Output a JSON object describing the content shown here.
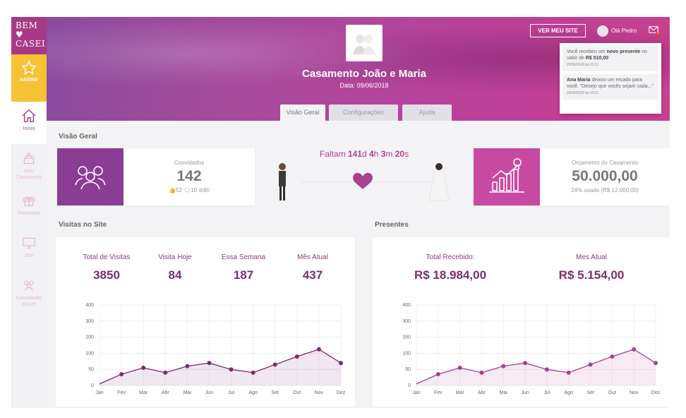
{
  "brand": {
    "logo_text_line1": "BEM ♥",
    "logo_text_line2": "CASEI"
  },
  "sidebar": {
    "assine_label": "ASSINE",
    "items": [
      {
        "label": "Início",
        "icon": "home-icon"
      },
      {
        "label": "Meu Casamento",
        "icon": "cake-icon"
      },
      {
        "label": "Presentes",
        "icon": "gift-icon"
      },
      {
        "label": "Site",
        "icon": "monitor-icon"
      },
      {
        "label": "Convidados RSVP",
        "icon": "guests-icon"
      }
    ]
  },
  "header": {
    "title": "Casamento João e Maria",
    "date": "Data: 09/06/2018",
    "tabs": [
      "Visão Geral",
      "Configurações",
      "Ajuda"
    ],
    "ver_site": "VER MEU SITE",
    "user": "Olá Pedro",
    "mail_count": "2",
    "notifications": [
      {
        "prefix": "Você recebeu um ",
        "bold": "novo presente",
        "mid": " no valor de ",
        "bold2": "R$ 510,00",
        "date": "20/06/2018 às 15:21"
      },
      {
        "prefix": "",
        "bold": "Ana Maria",
        "mid": " deixou um recado para você. \"Desejo que vocês sejam cada...\"",
        "bold2": "",
        "date": "20/06/2018 às 15:21"
      }
    ]
  },
  "overview": {
    "section_title": "Visão Geral",
    "guests": {
      "label": "Convidados",
      "value": "142",
      "meta": "👍52  🗨10  ⊘80"
    },
    "countdown": {
      "prefix": "Faltam",
      "days": "141",
      "hours": "4",
      "minutes": "3",
      "seconds": "20"
    },
    "budget": {
      "label": "Orçamento do Casamento",
      "value": "50.000,00",
      "meta": "24% usado (R$ 12.000,00)"
    }
  },
  "visits": {
    "section_title": "Visitas no Site",
    "kpis": [
      {
        "label": "Total de Visitas",
        "value": "3850"
      },
      {
        "label": "Visita Hoje",
        "value": "84"
      },
      {
        "label": "Essa Semana",
        "value": "187"
      },
      {
        "label": "Mês Atual",
        "value": "437"
      }
    ]
  },
  "gifts": {
    "section_title": "Presentes",
    "kpis": [
      {
        "label": "Total Recebido:",
        "value": "R$ 18.984,00"
      },
      {
        "label": "Mes Atual",
        "value": "R$ 5.154,00"
      }
    ]
  },
  "colors": {
    "accent": "#a8418e",
    "line": "#7b2d6e",
    "budget": "#c84aa0",
    "guests": "#8b3c95"
  },
  "chart_data": [
    {
      "type": "area",
      "title": "",
      "categories": [
        "Jan",
        "Fev",
        "Mar",
        "Abr",
        "Mai",
        "Jun",
        "Jul",
        "Ago",
        "Set",
        "Out",
        "Nov",
        "Dez"
      ],
      "series": [
        {
          "values": [
            5,
            35,
            55,
            40,
            60,
            70,
            50,
            40,
            65,
            90,
            125,
            70
          ]
        }
      ],
      "ylim": [
        0,
        400
      ],
      "yticks": [
        0,
        50,
        100,
        200,
        300,
        400
      ],
      "ytick_labels": [
        "0",
        "50",
        "100",
        "200",
        "300",
        "400"
      ],
      "grid": true
    },
    {
      "type": "area",
      "title": "",
      "categories": [
        "Jan",
        "Fev",
        "Mar",
        "Abr",
        "Mai",
        "Jun",
        "Jul",
        "Ago",
        "Set",
        "Out",
        "Nov",
        "Dez"
      ],
      "series": [
        {
          "values": [
            5,
            35,
            55,
            40,
            60,
            70,
            50,
            40,
            65,
            90,
            125,
            70
          ]
        }
      ],
      "ylim": [
        0,
        400
      ],
      "yticks": [
        0,
        50,
        100,
        200,
        300,
        400
      ],
      "ytick_labels": [
        "0",
        "50",
        "100",
        "200",
        "300",
        "400"
      ],
      "grid": true
    }
  ]
}
